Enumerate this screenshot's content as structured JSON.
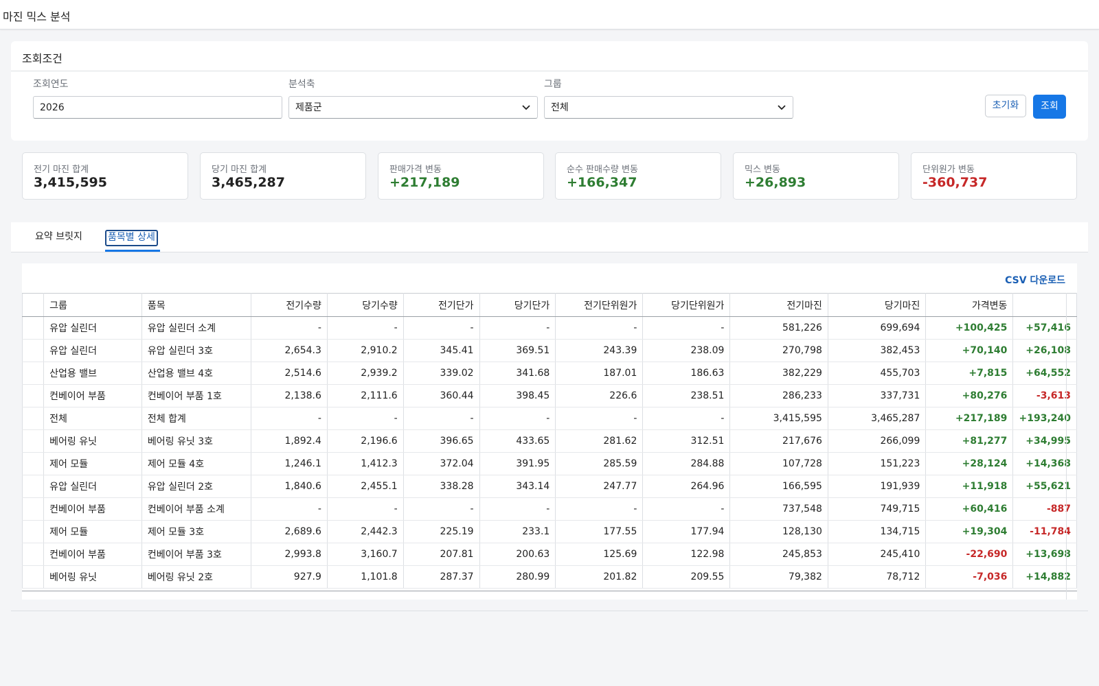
{
  "app": {
    "title": "마진 믹스 분석"
  },
  "filters": {
    "title": "조회조건",
    "year": {
      "label": "조회연도",
      "value": "2026"
    },
    "axis": {
      "label": "분석축",
      "value": "제품군"
    },
    "group": {
      "label": "그룹",
      "value": "전체"
    },
    "reset_label": "초기화",
    "search_label": "조회"
  },
  "kpis": [
    {
      "label": "전기 마진 합계",
      "value": "3,415,595",
      "tone": "plain"
    },
    {
      "label": "당기 마진 합계",
      "value": "3,465,287",
      "tone": "plain"
    },
    {
      "label": "판매가격 변동",
      "value": "+217,189",
      "tone": "pos"
    },
    {
      "label": "순수 판매수량 변동",
      "value": "+166,347",
      "tone": "pos"
    },
    {
      "label": "믹스 변동",
      "value": "+26,893",
      "tone": "pos"
    },
    {
      "label": "단위원가 변동",
      "value": "-360,737",
      "tone": "neg"
    }
  ],
  "tabs": [
    {
      "label": "요약 브릿지",
      "active": false
    },
    {
      "label": "품목별 상세",
      "active": true
    }
  ],
  "table": {
    "csv_label": "CSV 다운로드",
    "columns": [
      "그룹",
      "품목",
      "전기수량",
      "당기수량",
      "전기단가",
      "당기단가",
      "전기단위원가",
      "당기단위원가",
      "전기마진",
      "당기마진",
      "가격변동",
      ""
    ],
    "rows": [
      [
        "유압 실린더",
        "유압 실린더 소계",
        "-",
        "-",
        "-",
        "-",
        "-",
        "-",
        "581,226",
        "699,694",
        "+100,425",
        "+57,416"
      ],
      [
        "유압 실린더",
        "유압 실린더 3호",
        "2,654.3",
        "2,910.2",
        "345.41",
        "369.51",
        "243.39",
        "238.09",
        "270,798",
        "382,453",
        "+70,140",
        "+26,108"
      ],
      [
        "산업용 밸브",
        "산업용 밸브 4호",
        "2,514.6",
        "2,939.2",
        "339.02",
        "341.68",
        "187.01",
        "186.63",
        "382,229",
        "455,703",
        "+7,815",
        "+64,552"
      ],
      [
        "컨베이어 부품",
        "컨베이어 부품 1호",
        "2,138.6",
        "2,111.6",
        "360.44",
        "398.45",
        "226.6",
        "238.51",
        "286,233",
        "337,731",
        "+80,276",
        "-3,613"
      ],
      [
        "전체",
        "전체 합계",
        "-",
        "-",
        "-",
        "-",
        "-",
        "-",
        "3,415,595",
        "3,465,287",
        "+217,189",
        "+193,240"
      ],
      [
        "베어링 유닛",
        "베어링 유닛 3호",
        "1,892.4",
        "2,196.6",
        "396.65",
        "433.65",
        "281.62",
        "312.51",
        "217,676",
        "266,099",
        "+81,277",
        "+34,995"
      ],
      [
        "제어 모듈",
        "제어 모듈 4호",
        "1,246.1",
        "1,412.3",
        "372.04",
        "391.95",
        "285.59",
        "284.88",
        "107,728",
        "151,223",
        "+28,124",
        "+14,368"
      ],
      [
        "유압 실린더",
        "유압 실린더 2호",
        "1,840.6",
        "2,455.1",
        "338.28",
        "343.14",
        "247.77",
        "264.96",
        "166,595",
        "191,939",
        "+11,918",
        "+55,621"
      ],
      [
        "컨베이어 부품",
        "컨베이어 부품 소계",
        "-",
        "-",
        "-",
        "-",
        "-",
        "-",
        "737,548",
        "749,715",
        "+60,416",
        "-887"
      ],
      [
        "제어 모듈",
        "제어 모듈 3호",
        "2,689.6",
        "2,442.3",
        "225.19",
        "233.1",
        "177.55",
        "177.94",
        "128,130",
        "134,715",
        "+19,304",
        "-11,784"
      ],
      [
        "컨베이어 부품",
        "컨베이어 부품 3호",
        "2,993.8",
        "3,160.7",
        "207.81",
        "200.63",
        "125.69",
        "122.98",
        "245,853",
        "245,410",
        "-22,690",
        "+13,698"
      ],
      [
        "베어링 유닛",
        "베어링 유닛 2호",
        "927.9",
        "1,101.8",
        "287.37",
        "280.99",
        "201.82",
        "209.55",
        "79,382",
        "78,712",
        "-7,036",
        "+14,882"
      ]
    ]
  },
  "colors": {
    "positive": "#2e7d32",
    "negative": "#c62828",
    "accent": "#1677e6",
    "link": "#1a5fb4"
  }
}
